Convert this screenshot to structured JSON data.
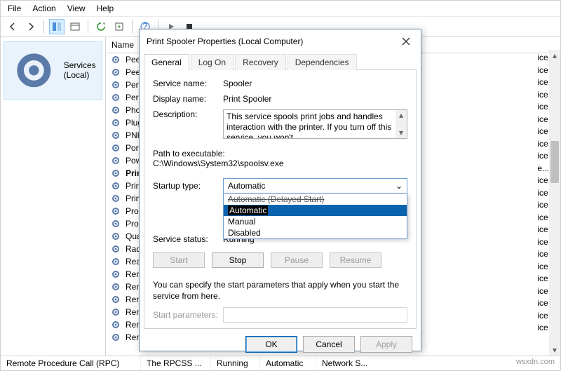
{
  "menubar": {
    "file": "File",
    "action": "Action",
    "view": "View",
    "help": "Help"
  },
  "left_tree": {
    "root": "Services (Local)"
  },
  "columns": {
    "name": "Name"
  },
  "services": {
    "items": [
      "Peer Netw",
      "Peer Netw",
      "Performa",
      "Performa",
      "Phone Se",
      "Plug and",
      "PNRP Ma",
      "Portable D",
      "Power",
      "Print Spoo",
      "Printer Ex",
      "PrintWork",
      "Problem F",
      "Program C",
      "Quality W",
      "Radio Ma",
      "Realtek A",
      "Remote A",
      "Remote A",
      "Remote D",
      "Remote D",
      "Remote D",
      "Remote D"
    ],
    "selected_index": 9,
    "trail": [
      "ice",
      "ice",
      "ice",
      "ice",
      "ice",
      "ice",
      "ice",
      "ice",
      "ice",
      "e...",
      "ice",
      "ice",
      "ice",
      "ice",
      "ice",
      "ice",
      "ice",
      "ice",
      "ice",
      "ice",
      "ice",
      "ice",
      "ice"
    ]
  },
  "statusbar": {
    "name": "Remote Procedure Call (RPC)",
    "desc": "The RPCSS ...",
    "status": "Running",
    "startup": "Automatic",
    "logon": "Network S..."
  },
  "dialog": {
    "title": "Print Spooler Properties (Local Computer)",
    "tabs": {
      "general": "General",
      "logon": "Log On",
      "recovery": "Recovery",
      "dependencies": "Dependencies"
    },
    "labels": {
      "service_name": "Service name:",
      "display_name": "Display name:",
      "description": "Description:",
      "path": "Path to executable:",
      "startup_type": "Startup type:",
      "service_status": "Service status:",
      "start_parameters": "Start parameters:"
    },
    "values": {
      "service_name": "Spooler",
      "display_name": "Print Spooler",
      "description": "This service spools print jobs and handles interaction with the printer.  If you turn off this service, you won't",
      "path": "C:\\Windows\\System32\\spoolsv.exe",
      "startup_selected": "Automatic",
      "service_status": "Running"
    },
    "startup_options": {
      "delayed": "Automatic (Delayed Start)",
      "automatic": "Automatic",
      "manual": "Manual",
      "disabled": "Disabled"
    },
    "buttons": {
      "start": "Start",
      "stop": "Stop",
      "pause": "Pause",
      "resume": "Resume",
      "ok": "OK",
      "cancel": "Cancel",
      "apply": "Apply"
    },
    "note": "You can specify the start parameters that apply when you start the service from here."
  },
  "watermark": "wsxdn.com"
}
